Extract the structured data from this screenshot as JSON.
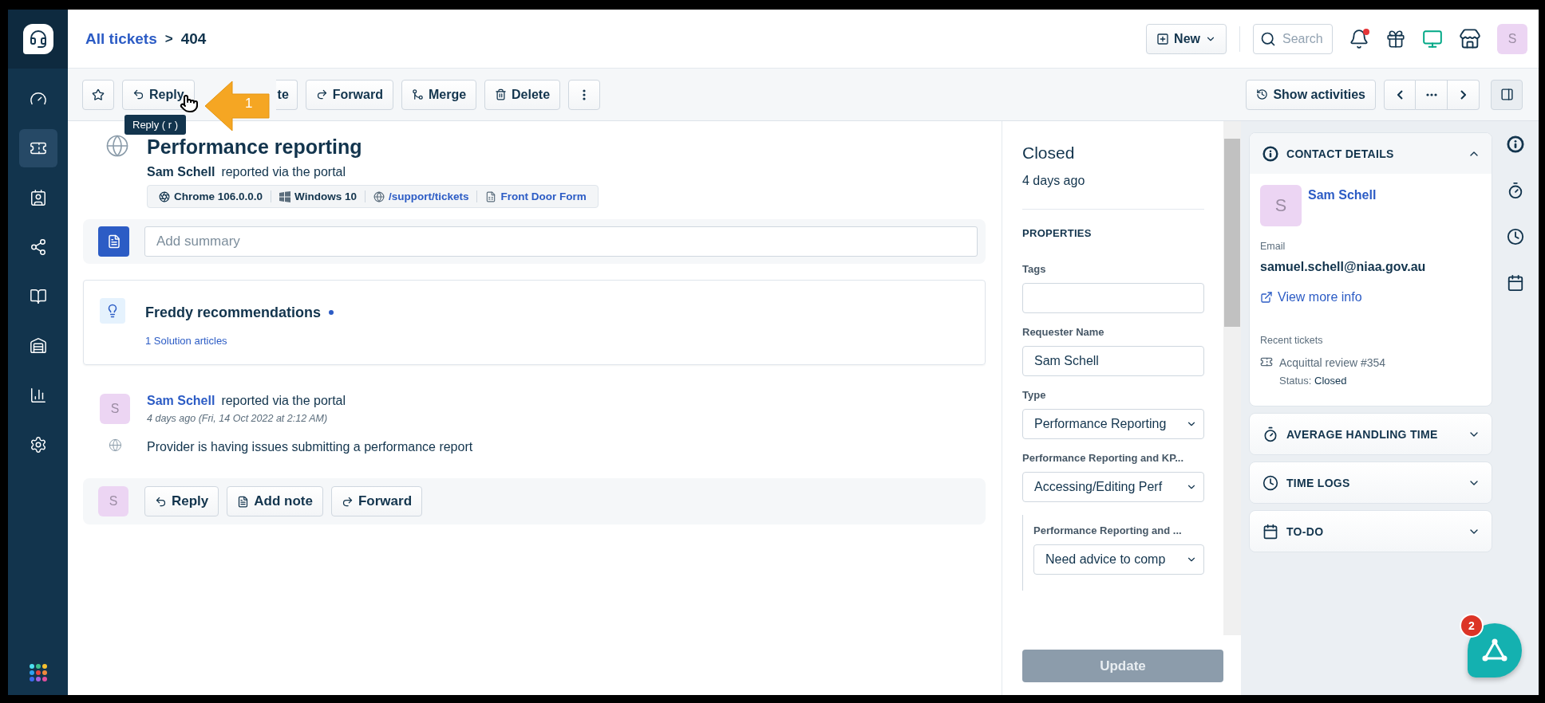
{
  "sidebar": {
    "items": [
      {
        "selected": false
      },
      {
        "selected": true
      },
      {
        "selected": false
      },
      {
        "selected": false
      },
      {
        "selected": false
      },
      {
        "selected": false
      },
      {
        "selected": false
      },
      {
        "selected": false
      }
    ]
  },
  "header": {
    "breadcrumb": {
      "link": "All tickets",
      "separator": ">",
      "current": "404"
    },
    "new_button": "New",
    "search": {
      "placeholder": "Search"
    },
    "notification_dot": true,
    "avatar": "S"
  },
  "toolbar": {
    "buttons": [
      "Reply",
      "te",
      "Forward",
      "Merge",
      "Delete"
    ],
    "show_activities": "Show activities",
    "tooltip": "Reply ( r )",
    "annotation": {
      "number": "1"
    }
  },
  "ticket": {
    "title": "Performance reporting",
    "requester": "Sam Schell",
    "via": "reported via the portal",
    "meta": [
      {
        "kind": "text",
        "text": "Chrome 106.0.0.0"
      },
      {
        "kind": "text",
        "text": "Windows 10"
      },
      {
        "kind": "link",
        "text": "/support/tickets"
      },
      {
        "kind": "link",
        "text": "Front Door Form"
      }
    ],
    "summary": {
      "placeholder": "Add summary"
    },
    "freddy": {
      "title": "Freddy recommendations",
      "link": "1 Solution articles"
    },
    "message": {
      "avatar": "S",
      "author": "Sam Schell",
      "via": "reported via the portal",
      "time": "4 days ago (Fri, 14 Oct 2022 at 2:12 AM)",
      "body": "Provider is having issues submitting a performance report"
    },
    "reply_bar": {
      "avatar": "S",
      "buttons": [
        "Reply",
        "Add note",
        "Forward"
      ]
    }
  },
  "properties": {
    "status": "Closed",
    "age": "4 days ago",
    "heading": "PROPERTIES",
    "fields": [
      {
        "kind": "text",
        "label": "Tags"
      },
      {
        "kind": "text",
        "label": "Requester Name",
        "value": "Sam Schell"
      },
      {
        "kind": "select",
        "label": "Type",
        "value": "Performance Reporting"
      },
      {
        "kind": "select",
        "label": "Performance Reporting and KP...",
        "value": "Accessing/Editing Perf",
        "children": [
          {
            "kind": "select",
            "label": "Performance Reporting and ...",
            "value": "Need advice to comp"
          }
        ]
      }
    ],
    "update_button": {
      "label": "Update",
      "disabled": true
    }
  },
  "contact": {
    "heading": "CONTACT DETAILS",
    "expanded": true,
    "avatar": "S",
    "name": "Sam Schell",
    "email_label": "Email",
    "email": "samuel.schell@niaa.gov.au",
    "more": "View more info",
    "recent_label": "Recent tickets",
    "recent": {
      "title": "Acquittal review #354",
      "status_label": "Status:",
      "status": "Closed"
    }
  },
  "sections": [
    {
      "heading": "AVERAGE HANDLING TIME",
      "expanded": false
    },
    {
      "heading": "TIME LOGS",
      "expanded": false
    },
    {
      "heading": "TO-DO",
      "expanded": false
    }
  ],
  "fab": {
    "badge": "2"
  }
}
